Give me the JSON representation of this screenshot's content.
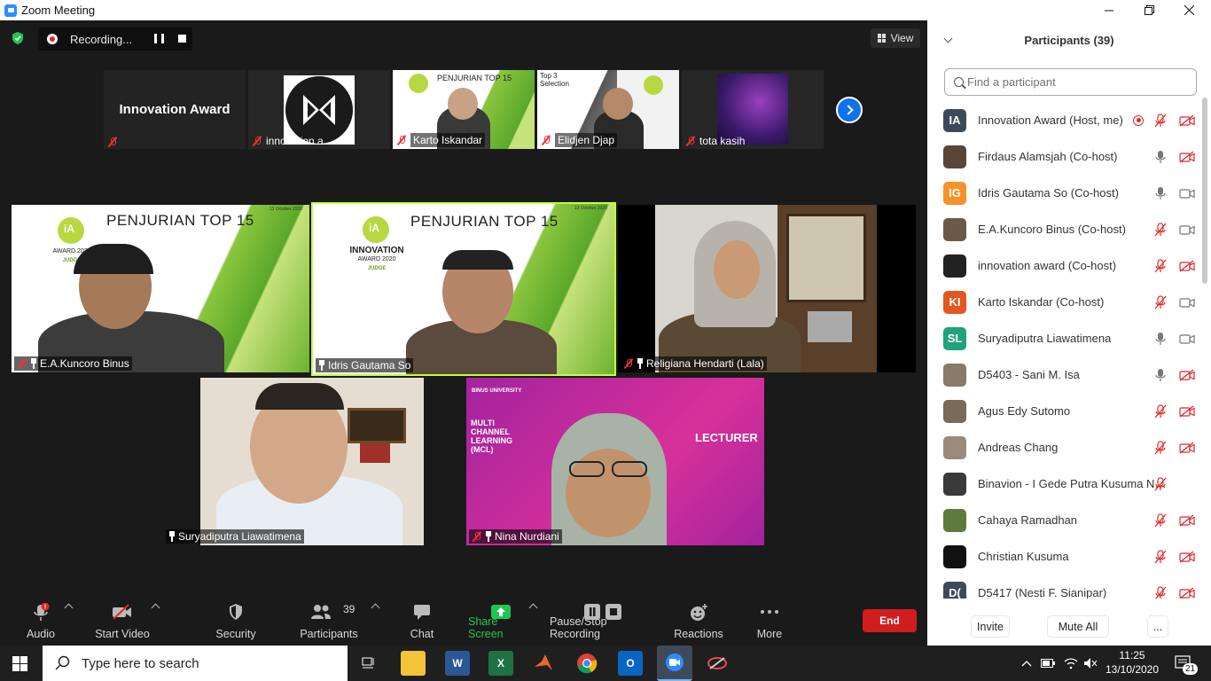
{
  "window": {
    "title": "Zoom Meeting"
  },
  "recording": {
    "label": "Recording..."
  },
  "view_button": {
    "label": "View"
  },
  "thumbnails": [
    {
      "title": "Innovation Award",
      "name": ""
    },
    {
      "name": "innovation a..."
    },
    {
      "name": "Karto Iskandar",
      "slide": "PENJURIAN TOP 15"
    },
    {
      "name": "Elidjen Djap",
      "slide": "Top 3 Selection"
    },
    {
      "name": "tota kasih"
    }
  ],
  "tiles": [
    {
      "name": "E.A.Kuncoro Binus",
      "slide_title": "PENJURIAN TOP 15",
      "date": "13 October 2020",
      "logo_small": "AWARD 2020",
      "logo_role": "JUDGE"
    },
    {
      "name": "Idris Gautama So",
      "slide_title": "PENJURIAN TOP 15",
      "date": "13 October 2020",
      "logo_big": "INNOVATION",
      "logo_small": "AWARD 2020",
      "logo_role": "JUDGE"
    },
    {
      "name": "Religiana Hendarti (Lala)"
    },
    {
      "name": "Suryadiputra Liawatimena"
    },
    {
      "name": "Nina Nurdiani",
      "bg_text_1": "MULTI CHANNEL LEARNING (MCL)",
      "bg_text_2": "LECTURER",
      "brand": "BINUS UNIVERSITY"
    }
  ],
  "toolbar": {
    "audio": "Audio",
    "video": "Start Video",
    "security": "Security",
    "participants": "Participants",
    "participants_count": "39",
    "chat": "Chat",
    "share": "Share Screen",
    "recording": "Pause/Stop Recording",
    "reactions": "Reactions",
    "more": "More",
    "end": "End"
  },
  "panel": {
    "title": "Participants (39)",
    "search_placeholder": "Find a participant",
    "participants": [
      {
        "initials": "IA",
        "name": "Innovation Award (Host, me)",
        "color": "#3d4a5c",
        "mic": "muted",
        "cam": "off",
        "recording": true
      },
      {
        "initials": "",
        "name": "Firdaus Alamsjah (Co-host)",
        "color": "#5a4636",
        "mic": "on",
        "cam": "off"
      },
      {
        "initials": "IG",
        "name": "Idris Gautama So (Co-host)",
        "color": "#f5922a",
        "mic": "on",
        "cam": "on"
      },
      {
        "initials": "",
        "name": "E.A.Kuncoro Binus (Co-host)",
        "color": "#6b5a48",
        "mic": "muted",
        "cam": "on"
      },
      {
        "initials": "",
        "name": "innovation award (Co-host)",
        "color": "#222222",
        "mic": "muted",
        "cam": "off"
      },
      {
        "initials": "KI",
        "name": "Karto Iskandar (Co-host)",
        "color": "#e0581f",
        "mic": "muted",
        "cam": "on"
      },
      {
        "initials": "SL",
        "name": "Suryadiputra Liawatimena",
        "color": "#1fa37a",
        "mic": "on",
        "cam": "on"
      },
      {
        "initials": "",
        "name": "D5403 - Sani M. Isa",
        "color": "#8a7a6a",
        "mic": "on",
        "cam": "off"
      },
      {
        "initials": "",
        "name": "Agus Edy Sutomo",
        "color": "#7a6a58",
        "mic": "muted",
        "cam": "off"
      },
      {
        "initials": "",
        "name": "Andreas Chang",
        "color": "#9a8a7a",
        "mic": "muted",
        "cam": "off"
      },
      {
        "initials": "",
        "name": "Binavion - I Gede Putra Kusuma Ne...",
        "color": "#3a3a3a",
        "mic": "muted",
        "cam": "none"
      },
      {
        "initials": "",
        "name": "Cahaya Ramadhan",
        "color": "#5f7a3a",
        "mic": "muted",
        "cam": "off"
      },
      {
        "initials": "",
        "name": "Christian Kusuma",
        "color": "#111111",
        "mic": "muted",
        "cam": "off"
      },
      {
        "initials": "D(",
        "name": "D5417 (Nesti F. Sianipar)",
        "color": "#3d4a5c",
        "mic": "muted",
        "cam": "off"
      }
    ],
    "invite": "Invite",
    "mute_all": "Mute All",
    "more": "..."
  },
  "taskbar": {
    "search_placeholder": "Type here to search",
    "time": "11:25",
    "date": "13/10/2020",
    "notifications": "21"
  }
}
